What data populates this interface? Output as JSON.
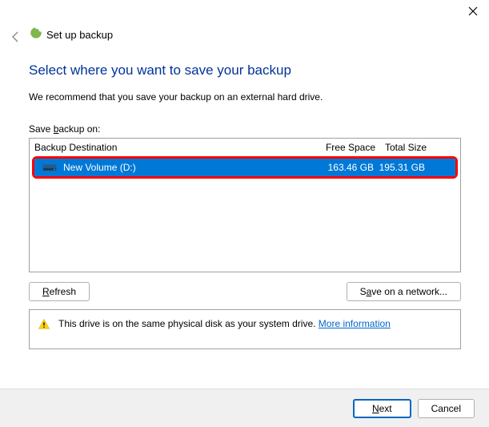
{
  "window": {
    "title": "Set up backup"
  },
  "heading": "Select where you want to save your backup",
  "recommendation": "We recommend that you save your backup on an external hard drive.",
  "save_label_pre": "Save ",
  "save_label_u": "b",
  "save_label_post": "ackup on:",
  "columns": {
    "dest": "Backup Destination",
    "free": "Free Space",
    "total": "Total Size"
  },
  "rows": [
    {
      "name": "New Volume (D:)",
      "free": "163.46 GB",
      "total": "195.31 GB"
    }
  ],
  "buttons": {
    "refresh_u": "R",
    "refresh_rest": "efresh",
    "save_net_pre": "S",
    "save_net_u": "a",
    "save_net_post": "ve on a network...",
    "next_u": "N",
    "next_rest": "ext",
    "cancel": "Cancel"
  },
  "warning": {
    "text": "This drive is on the same physical disk as your system drive. ",
    "link": "More information"
  }
}
